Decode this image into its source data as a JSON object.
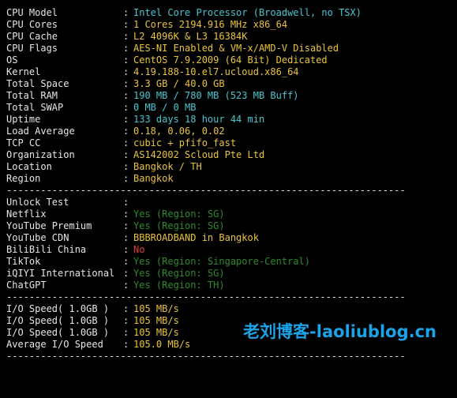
{
  "colors": {
    "background": "#000000",
    "label": "#e6e6e6",
    "cyan": "#48c6d0",
    "yellow": "#e9c43a",
    "green": "#2e8b2e",
    "red": "#e03a3a",
    "watermark": "#1aa3e8"
  },
  "divider": "----------------------------------------------------------------------",
  "system_info": [
    {
      "key": "CPU Model",
      "value": "Intel Core Processor (Broadwell, no TSX)",
      "color": "cyan"
    },
    {
      "key": "CPU Cores",
      "value": "1 Cores 2194.916 MHz x86_64",
      "color": "yellow"
    },
    {
      "key": "CPU Cache",
      "value": "L2 4096K & L3 16384K",
      "color": "yellow"
    },
    {
      "key": "CPU Flags",
      "value": "AES-NI Enabled & VM-x/AMD-V Disabled",
      "color": "yellow"
    },
    {
      "key": "OS",
      "value": "CentOS 7.9.2009 (64 Bit) Dedicated",
      "color": "yellow"
    },
    {
      "key": "Kernel",
      "value": "4.19.188-10.el7.ucloud.x86_64",
      "color": "yellow"
    },
    {
      "key": "Total Space",
      "value": "3.3 GB / 40.0 GB",
      "color": "yellow"
    },
    {
      "key": "Total RAM",
      "value": "190 MB / 780 MB (523 MB Buff)",
      "color": "cyan"
    },
    {
      "key": "Total SWAP",
      "value": "0 MB / 0 MB",
      "color": "cyan"
    },
    {
      "key": "Uptime",
      "value": "133 days 18 hour 44 min",
      "color": "cyan"
    },
    {
      "key": "Load Average",
      "value": "0.18, 0.06, 0.02",
      "color": "yellow"
    },
    {
      "key": "TCP CC",
      "value": "cubic + pfifo_fast",
      "color": "yellow"
    },
    {
      "key": "Organization",
      "value": "AS142002 Scloud Pte Ltd",
      "color": "yellow"
    },
    {
      "key": "Location",
      "value": "Bangkok / TH",
      "color": "yellow"
    },
    {
      "key": "Region",
      "value": "Bangkok",
      "color": "yellow"
    }
  ],
  "unlock_test": [
    {
      "key": "Unlock Test",
      "value": "",
      "color": "yellow"
    },
    {
      "key": "Netflix",
      "value": "Yes (Region: SG)",
      "color": "green"
    },
    {
      "key": "YouTube Premium",
      "value": "Yes (Region: SG)",
      "color": "green"
    },
    {
      "key": "YouTube CDN",
      "value": "BBBROADBAND in Bangkok",
      "color": "yellow"
    },
    {
      "key": "BiliBili China",
      "value": "No",
      "color": "red"
    },
    {
      "key": "TikTok",
      "value": "Yes (Region: Singapore-Central)",
      "color": "green"
    },
    {
      "key": "iQIYI International",
      "value": "Yes (Region: SG)",
      "color": "green"
    },
    {
      "key": "ChatGPT",
      "value": "Yes (Region: TH)",
      "color": "green"
    }
  ],
  "io_speed": [
    {
      "key": "I/O Speed( 1.0GB )",
      "value": "105 MB/s",
      "color": "yellow"
    },
    {
      "key": "I/O Speed( 1.0GB )",
      "value": "105 MB/s",
      "color": "yellow"
    },
    {
      "key": "I/O Speed( 1.0GB )",
      "value": "105 MB/s",
      "color": "yellow"
    },
    {
      "key": "Average I/O Speed",
      "value": "105.0 MB/s",
      "color": "yellow"
    }
  ],
  "watermark": "老刘博客-laoliublog.cn"
}
